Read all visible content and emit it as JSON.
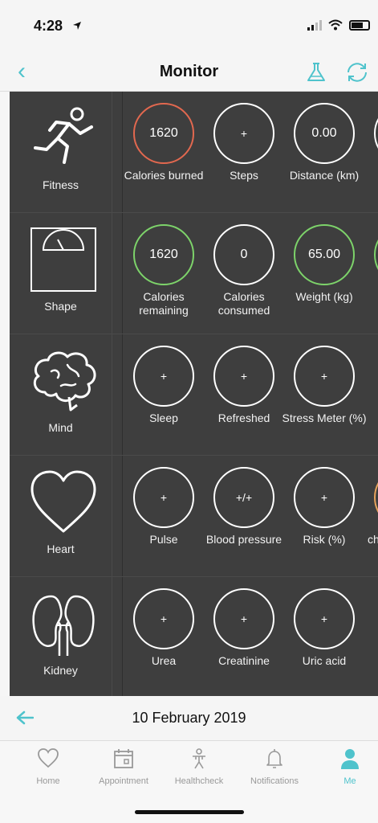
{
  "status_bar": {
    "time": "4:28"
  },
  "nav": {
    "title": "Monitor"
  },
  "categories": [
    {
      "label": "Fitness",
      "icon": "runner-icon"
    },
    {
      "label": "Shape",
      "icon": "scale-icon"
    },
    {
      "label": "Mind",
      "icon": "brain-icon"
    },
    {
      "label": "Heart",
      "icon": "heart-icon"
    },
    {
      "label": "Kidney",
      "icon": "kidney-icon"
    }
  ],
  "fitness": [
    {
      "value": "1620",
      "label": "Calories burned",
      "color": "#e2684f"
    },
    {
      "value": "+",
      "label": "Steps",
      "color": "#ffffff"
    },
    {
      "value": "0.00",
      "label": "Distance (km)",
      "color": "#ffffff"
    }
  ],
  "shape": [
    {
      "value": "1620",
      "label": "Calories remaining",
      "color": "#7dd36a"
    },
    {
      "value": "0",
      "label": "Calories consumed",
      "color": "#ffffff"
    },
    {
      "value": "65.00",
      "label": "Weight (kg)",
      "color": "#7dd36a"
    }
  ],
  "mind": [
    {
      "value": "+",
      "label": "Sleep"
    },
    {
      "value": "+",
      "label": "Refreshed"
    },
    {
      "value": "+",
      "label": "Stress Meter (%)"
    }
  ],
  "heart": [
    {
      "value": "+",
      "label": "Pulse"
    },
    {
      "value": "+/+",
      "label": "Blood pressure"
    },
    {
      "value": "+",
      "label": "Risk (%)"
    },
    {
      "value": "",
      "label": "ch",
      "color": "#e8a35c"
    }
  ],
  "kidney": [
    {
      "value": "+",
      "label": "Urea"
    },
    {
      "value": "+",
      "label": "Creatinine"
    },
    {
      "value": "+",
      "label": "Uric acid"
    }
  ],
  "date_bar": {
    "date": "10 February 2019"
  },
  "tabs": [
    {
      "label": "Home",
      "icon": "heart-outline-icon"
    },
    {
      "label": "Appointment",
      "icon": "calendar-icon"
    },
    {
      "label": "Healthcheck",
      "icon": "person-icon"
    },
    {
      "label": "Notifications",
      "icon": "bell-icon"
    },
    {
      "label": "Me",
      "icon": "user-icon",
      "active": true
    }
  ],
  "colors": {
    "accent": "#4fc3cc",
    "panel": "#3e3e3e",
    "alert": "#e2684f",
    "ok": "#7dd36a",
    "warn": "#e8a35c"
  }
}
